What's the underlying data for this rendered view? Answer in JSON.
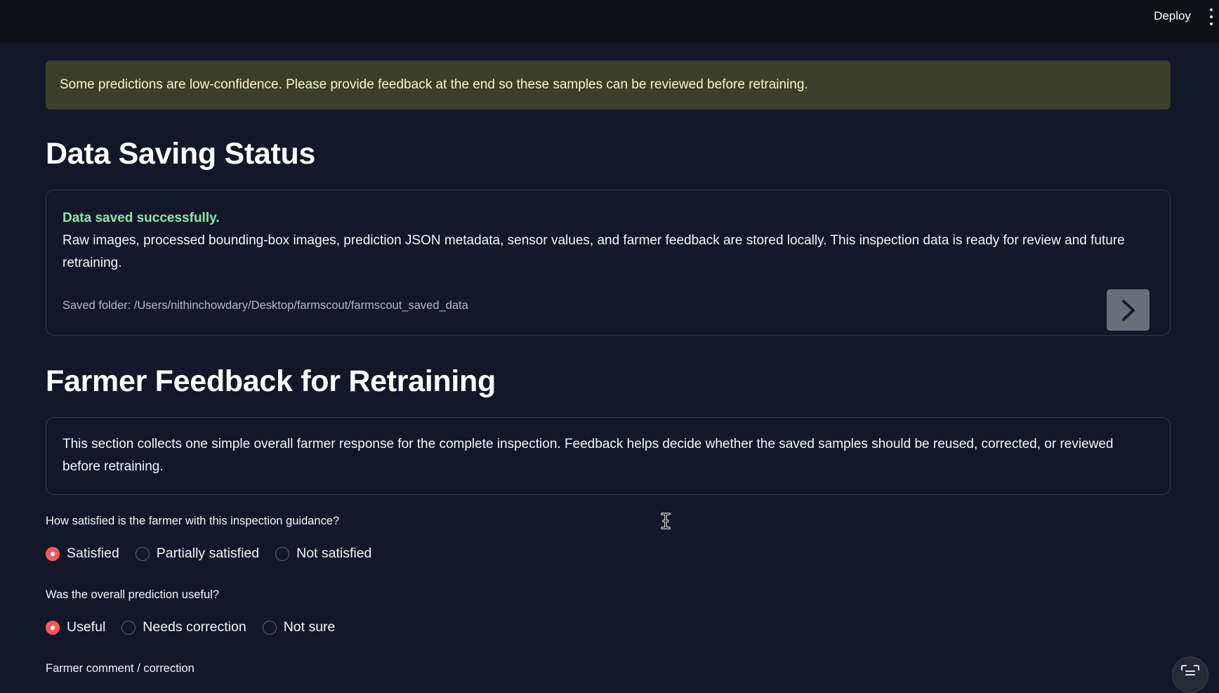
{
  "topbar": {
    "deploy_label": "Deploy",
    "menu_icon": "kebab-menu-icon"
  },
  "warning": {
    "text": "Some predictions are low-confidence. Please provide feedback at the end so these samples can be reviewed before retraining."
  },
  "data_saving": {
    "title": "Data Saving Status",
    "success": "Data saved successfully.",
    "description": "Raw images, processed bounding-box images, prediction JSON metadata, sensor values, and farmer feedback are stored locally. This inspection data is ready for review and future retraining.",
    "folder": "Saved folder: /Users/nithinchowdary/Desktop/farmscout/farmscout_saved_data",
    "arrow_icon": "chevron-right-icon"
  },
  "feedback": {
    "title": "Farmer Feedback for Retraining",
    "info": "This section collects one simple overall farmer response for the complete inspection. Feedback helps decide whether the saved samples should be reused, corrected, or reviewed before retraining.",
    "q1": {
      "label": "How satisfied is the farmer with this inspection guidance?",
      "options": [
        "Satisfied",
        "Partially satisfied",
        "Not satisfied"
      ],
      "selected": "Satisfied"
    },
    "q2": {
      "label": "Was the overall prediction useful?",
      "options": [
        "Useful",
        "Needs correction",
        "Not sure"
      ],
      "selected": "Useful"
    },
    "comment_label": "Farmer comment / correction"
  },
  "colors": {
    "background": "#121729",
    "accent": "#f25a5a",
    "success": "#8ce8a6",
    "warning_bg": "#3b3e2b"
  }
}
